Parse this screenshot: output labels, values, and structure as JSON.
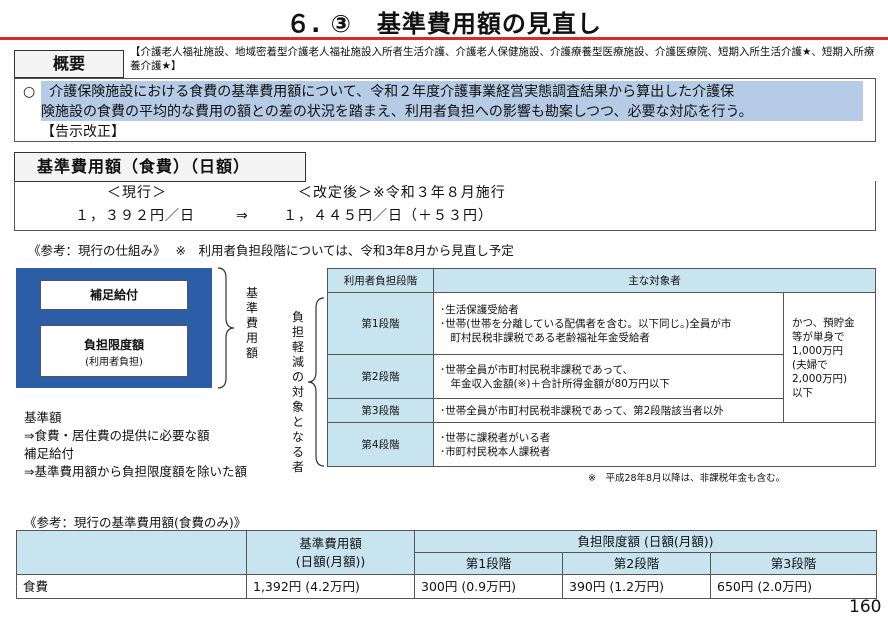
{
  "title": "６. ③　基準費用額の見直し",
  "overview": {
    "label": "概要",
    "targets": "【介護老人福祉施設、地域密着型介護老人福祉施設入所者生活介護、介護老人保健施設、介護療養型医療施設、介護医療院、短期入所生活介護★、短期入所療養介護★】",
    "text_line1": "○　介護保険施設における食費の基準費用額について、令和２年度介護事業経営実態調査結果から算出した介護保",
    "text_line2": "険施設の食費の平均的な費用の額との差の状況を踏まえ、利用者負担への影響も勘案しつつ、必要な対応を行う。",
    "text_line3": "【告示改正】"
  },
  "kijun": {
    "header": "基準費用額（食費）（日額）",
    "current_label": "＜現行＞",
    "revised_label": "＜改定後＞※令和３年８月施行",
    "current_value": "１，３９２円／日",
    "arrow": "⇒",
    "revised_value": "１，４４５円／日（＋５３円）"
  },
  "reference1": {
    "title": "《参考：現行の仕組み》",
    "note": "※　利用者負担段階については、令和3年8月から見直し予定"
  },
  "diagram": {
    "hosoku_label": "補足給付",
    "futan_label": "負担限度額",
    "futan_sub": "(利用者負担)",
    "kijun_vertical": "基準費用額",
    "taisho_vertical": "負担軽減の対象となる者"
  },
  "kijun_note": {
    "line1": "基準額",
    "line2": "⇒食費・居住費の提供に必要な額",
    "line3": "補足給付",
    "line4": "⇒基準費用額から負担限度額を除いた額"
  },
  "stage_table": {
    "header_level": "利用者負担段階",
    "header_target": "主な対象者",
    "rows": [
      {
        "level": "第1段階",
        "line1": "･生活保護受給者",
        "line2": "･世帯(世帯を分離している配偶者を含む。以下同じ。)全員が市",
        "line3": "　町村民税非課税である老齢福祉年金受給者"
      },
      {
        "level": "第2段階",
        "line1": "･世帯全員が市町村民税非課税であって、",
        "line2": "　年金収入金額(※)＋合計所得金額が80万円以下"
      },
      {
        "level": "第3段階",
        "line1": "･世帯全員が市町村民税非課税であって、第2段階該当者以外"
      },
      {
        "level": "第4段階",
        "line1": "･世帯に課税者がいる者",
        "line2": "･市町村民税本人課税者"
      }
    ],
    "asset_condition": {
      "line1": "かつ、預貯金",
      "line2": "等が単身で",
      "line3": "1,000万円",
      "line4": "(夫婦で",
      "line5": "2,000万円)",
      "line6": "以下"
    },
    "footnote": "※　平成28年8月以降は、非課税年金も含む。"
  },
  "reference2": {
    "title": "《参考：現行の基準費用額(食費のみ)》",
    "header_kijun_line1": "基準費用額",
    "header_kijun_line2": "(日額(月額))",
    "header_limit": "負担限度額 (日額(月額))",
    "stages": [
      "第1段階",
      "第2段階",
      "第3段階"
    ],
    "row_label": "食費",
    "kijun_value": "1,392円 (4.2万円)",
    "stage_values": [
      "300円 (0.9万円)",
      "390円 (1.2万円)",
      "650円 (2.0万円)"
    ]
  },
  "page_number": "160"
}
